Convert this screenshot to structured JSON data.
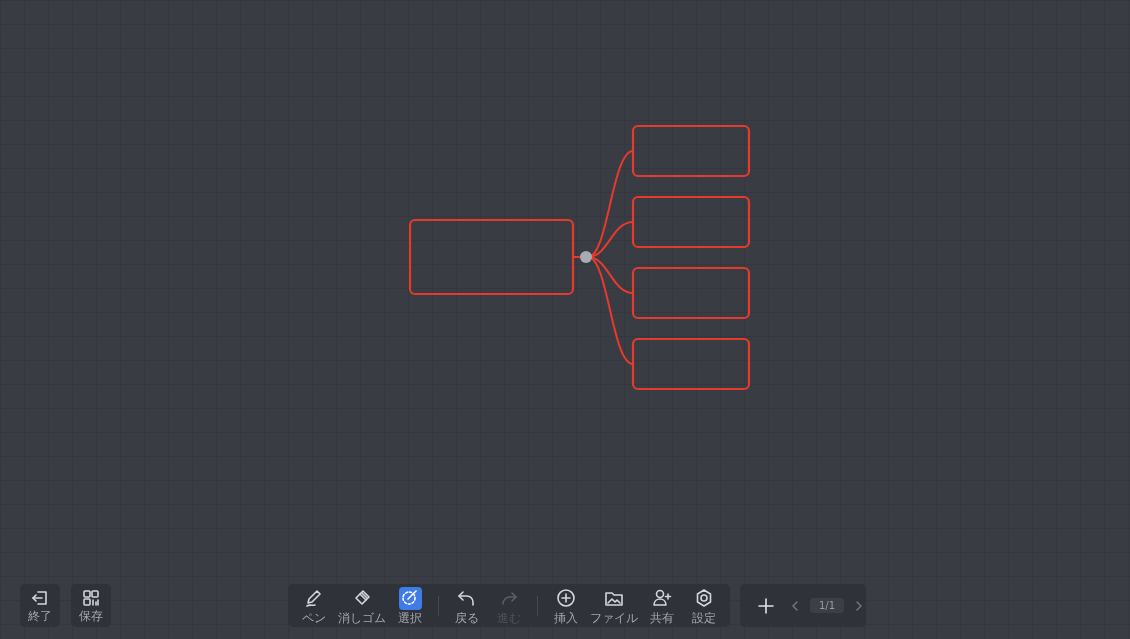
{
  "mindmap": {
    "selected": true,
    "children": [
      {
        "selected": true
      },
      {
        "selected": true
      },
      {
        "selected": true
      },
      {
        "selected": true
      }
    ]
  },
  "side_buttons": [
    {
      "label": "終了"
    },
    {
      "label": "保存"
    }
  ],
  "tool_groups": [
    [
      {
        "label": "ペン",
        "selected": false
      },
      {
        "label": "消しゴム",
        "selected": false
      },
      {
        "label": "選択",
        "selected": true
      }
    ],
    [
      {
        "label": "戻る",
        "disabled": false
      },
      {
        "label": "進む",
        "disabled": true
      }
    ],
    [
      {
        "label": "挿入"
      },
      {
        "label": "ファイル"
      },
      {
        "label": "共有"
      },
      {
        "label": "設定"
      }
    ]
  ],
  "pager": {
    "page": "1/1"
  }
}
